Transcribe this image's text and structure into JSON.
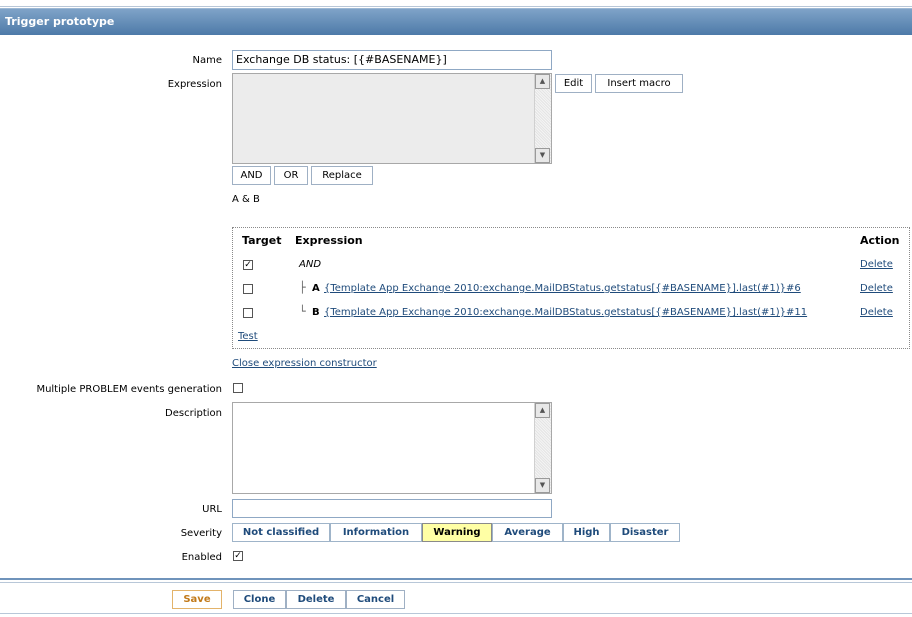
{
  "title": "Trigger prototype",
  "form": {
    "name_label": "Name",
    "name_value": "Exchange DB status: [{#BASENAME}]",
    "expression_label": "Expression",
    "expression_value": "",
    "edit_label": "Edit",
    "insert_macro_label": "Insert macro",
    "and_label": "AND",
    "or_label": "OR",
    "replace_label": "Replace",
    "expr_summary": "A & B",
    "multiple_problem_label": "Multiple PROBLEM events generation",
    "multiple_problem_checked": false,
    "description_label": "Description",
    "description_value": "",
    "url_label": "URL",
    "url_value": "",
    "severity_label": "Severity",
    "enabled_label": "Enabled",
    "enabled_checked": true
  },
  "constructor": {
    "headers": {
      "target": "Target",
      "expression": "Expression",
      "action": "Action"
    },
    "rows": [
      {
        "checked": true,
        "tree": "",
        "letter": "",
        "expression": "AND",
        "action": "Delete"
      },
      {
        "checked": false,
        "tree": "├",
        "letter": "A",
        "expression": "{Template App Exchange 2010:exchange.MailDBStatus.getstatus[{#BASENAME}].last(#1)}#6",
        "action": "Delete"
      },
      {
        "checked": false,
        "tree": "└",
        "letter": "B",
        "expression": "{Template App Exchange 2010:exchange.MailDBStatus.getstatus[{#BASENAME}].last(#1)}#11",
        "action": "Delete"
      }
    ],
    "test_label": "Test",
    "close_label": "Close expression constructor"
  },
  "severity": {
    "options": [
      "Not classified",
      "Information",
      "Warning",
      "Average",
      "High",
      "Disaster"
    ],
    "selected": "Warning"
  },
  "footer": {
    "save_label": "Save",
    "clone_label": "Clone",
    "delete_label": "Delete",
    "cancel_label": "Cancel"
  }
}
